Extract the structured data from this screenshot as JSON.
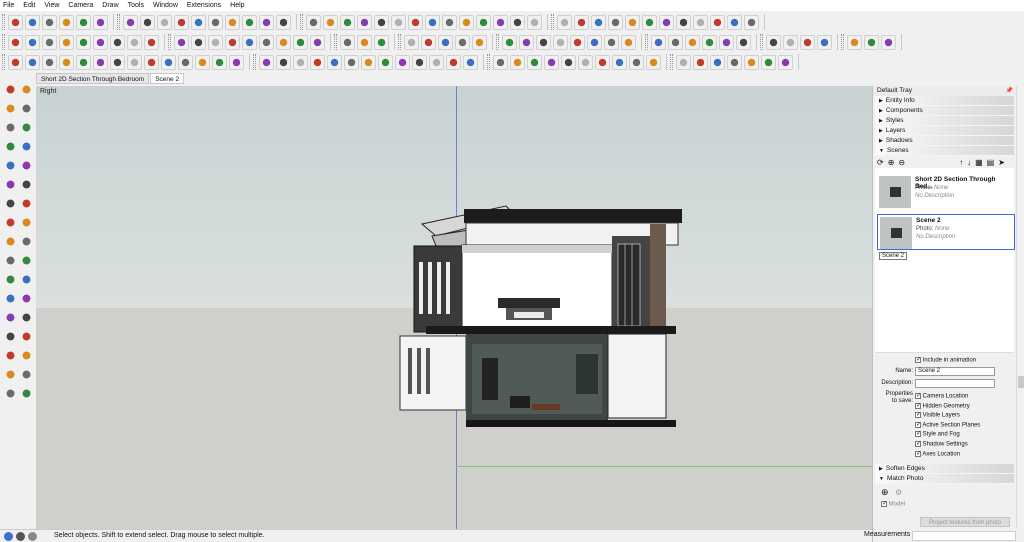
{
  "menu": [
    "File",
    "Edit",
    "View",
    "Camera",
    "Draw",
    "Tools",
    "Window",
    "Extensions",
    "Help"
  ],
  "scene_tabs": [
    "Short 2D Section Through Bedroom",
    "Scene 2"
  ],
  "viewport": {
    "view_label": "Right"
  },
  "tray": {
    "title": "Default Tray",
    "panels_collapsed": [
      "Entity Info",
      "Components",
      "Styles",
      "Layers",
      "Shadows"
    ],
    "scenes_panel": "Scenes",
    "scenes": [
      {
        "name": "Short 2D Section Through Bed...",
        "photo_label": "Photo:",
        "photo_value": "None",
        "description": "No Description"
      },
      {
        "name": "Scene 2",
        "photo_label": "Photo:",
        "photo_value": "None",
        "description": "No Description"
      }
    ],
    "tooltip": "Scene 2",
    "properties": {
      "include_in_animation": "Include in animation",
      "name_label": "Name:",
      "name_value": "Scene 2",
      "description_label": "Description:",
      "description_value": "",
      "properties_to_save_label_1": "Properties",
      "properties_to_save_label_2": "to save:",
      "checkboxes": [
        "Camera Location",
        "Hidden Geometry",
        "Visible Layers",
        "Active Section Planes",
        "Style and Fog",
        "Shadow Settings",
        "Axes Location"
      ]
    },
    "bottom_panels": [
      "Soften Edges",
      "Match Photo"
    ],
    "model_checkbox": "Model",
    "project_textures_button": "Project textures from photo"
  },
  "status": {
    "text": "Select objects. Shift to extend select. Drag mouse to select multiple.",
    "measurements_label": "Measurements",
    "measurements_value": ""
  },
  "colors": {
    "accent_select": "#3b6fd8",
    "blue_axis": "#6d7fd6",
    "green_axis": "#7fc07f"
  }
}
